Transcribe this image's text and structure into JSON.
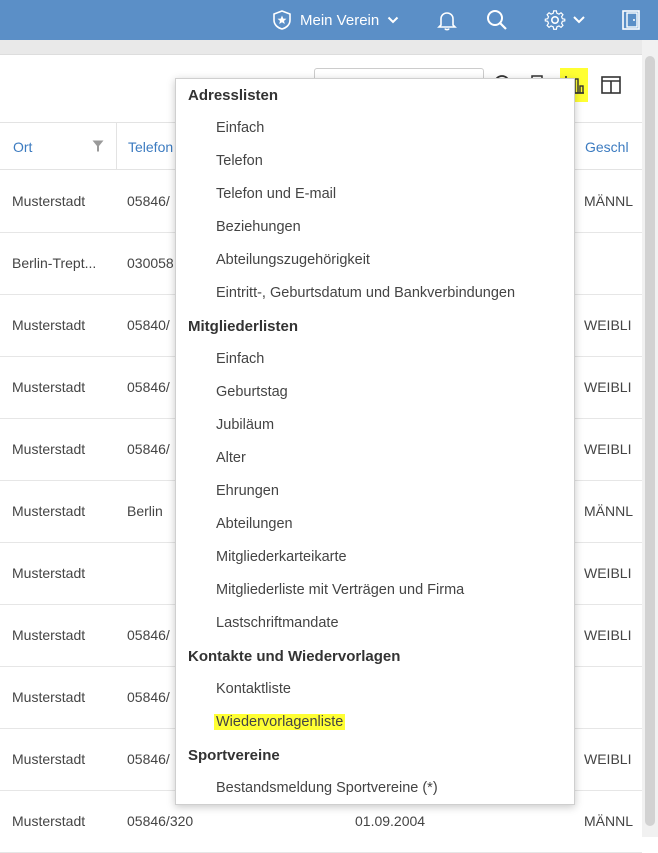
{
  "topbar": {
    "club_label": "Mein Verein"
  },
  "table": {
    "headers": {
      "ort": "Ort",
      "telefon": "Telefon",
      "geschlecht": "Geschl"
    },
    "rows": [
      {
        "ort": "Musterstadt",
        "telefon": "05846/",
        "datum": "",
        "geschlecht": "MÄNNL"
      },
      {
        "ort": "Berlin-Trept...",
        "telefon": "030058",
        "datum": "",
        "geschlecht": ""
      },
      {
        "ort": "Musterstadt",
        "telefon": "05840/",
        "datum": "",
        "geschlecht": "WEIBLI"
      },
      {
        "ort": "Musterstadt",
        "telefon": "05846/",
        "datum": "",
        "geschlecht": "WEIBLI"
      },
      {
        "ort": "Musterstadt",
        "telefon": "05846/",
        "datum": "",
        "geschlecht": "WEIBLI"
      },
      {
        "ort": "Musterstadt",
        "telefon": "Berlin",
        "datum": "",
        "geschlecht": "MÄNNL"
      },
      {
        "ort": "Musterstadt",
        "telefon": "",
        "datum": "",
        "geschlecht": "WEIBLI"
      },
      {
        "ort": "Musterstadt",
        "telefon": "05846/",
        "datum": "",
        "geschlecht": "WEIBLI"
      },
      {
        "ort": "Musterstadt",
        "telefon": "05846/",
        "datum": "",
        "geschlecht": ""
      },
      {
        "ort": "Musterstadt",
        "telefon": "05846/",
        "datum": "",
        "geschlecht": "WEIBLI"
      },
      {
        "ort": "Musterstadt",
        "telefon": "05846/320",
        "datum": "01.09.2004",
        "geschlecht": "MÄNNL"
      }
    ]
  },
  "menu": {
    "groups": [
      {
        "title": "Adresslisten",
        "items": [
          "Einfach",
          "Telefon",
          "Telefon und E-mail",
          "Beziehungen",
          "Abteilungszugehörigkeit",
          "Eintritt-, Geburtsdatum und Bankverbindungen"
        ]
      },
      {
        "title": "Mitgliederlisten",
        "items": [
          "Einfach",
          "Geburtstag",
          "Jubiläum",
          "Alter",
          "Ehrungen",
          "Abteilungen",
          "Mitgliederkarteikarte",
          "Mitgliederliste mit Verträgen und Firma",
          "Lastschriftmandate"
        ]
      },
      {
        "title": "Kontakte und Wiedervorlagen",
        "items": [
          "Kontaktliste",
          "Wiedervorlagenliste"
        ]
      },
      {
        "title": "Sportvereine",
        "items": [
          "Bestandsmeldung Sportvereine (*)"
        ]
      }
    ]
  },
  "colors": {
    "topbar": "#5b8fc7",
    "link": "#3c7bc0",
    "highlight": "#ffff33"
  },
  "icons": [
    "shield-star-icon",
    "chevron-down-icon",
    "bell-icon",
    "search-icon",
    "gear-icon",
    "exit-door-icon",
    "filter-icon",
    "reports-chart-icon",
    "columns-icon"
  ]
}
